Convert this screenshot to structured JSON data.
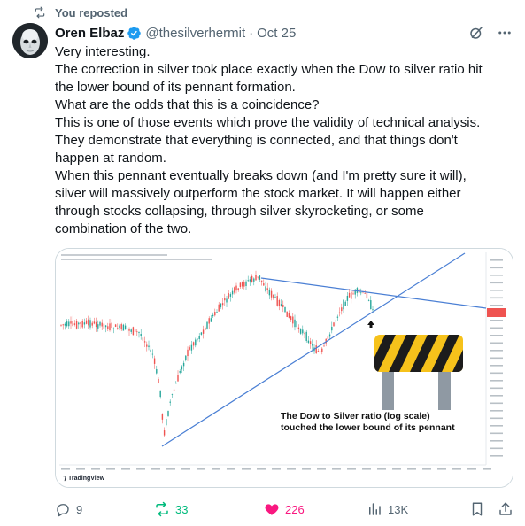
{
  "repost": {
    "label": "You reposted",
    "icon": "repost-icon"
  },
  "author": {
    "name": "Oren Elbaz",
    "handle": "@thesilverhermit",
    "separator": "·",
    "date": "Oct 25",
    "verified_color": "#1d9bf0"
  },
  "tweet": {
    "lines": [
      "Very interesting.",
      "The correction in silver took place exactly when the Dow to silver ratio hit",
      "the lower bound of its pennant formation.",
      "What are the odds that this is a coincidence?",
      "This is one of those events which prove the validity of technical analysis.",
      "They demonstrate that everything is connected, and that things don't",
      "happen at random.",
      "When this pennant eventually breaks down (and I'm pretty sure it will),",
      "silver will massively outperform the stock market. It will happen either",
      "through stocks collapsing, through silver skyrocketing, or some",
      "combination of the two."
    ]
  },
  "media": {
    "annotation_line1": "The Dow to Silver ratio (log scale)",
    "annotation_line2": "touched the lower bound of its pennant",
    "watermark": "TradingView",
    "colors": {
      "up": "#26a69a",
      "down": "#ef5350",
      "trendline": "#4a7fd4",
      "price_label": "#ef5350"
    }
  },
  "actions": {
    "reply_count": "9",
    "repost_count": "33",
    "like_count": "226",
    "views_count": "13K",
    "repost_color": "#00ba7c",
    "like_color": "#f91880"
  }
}
